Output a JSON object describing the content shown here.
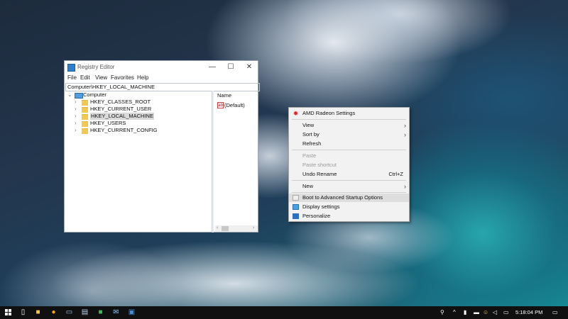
{
  "regedit": {
    "title": "Registry Editor",
    "controls": {
      "minimize": "—",
      "maximize": "☐",
      "close": "✕"
    },
    "menu": [
      "File",
      "Edit",
      "View",
      "Favorites",
      "Help"
    ],
    "address": "Computer\\HKEY_LOCAL_MACHINE",
    "tree": {
      "root": "Computer",
      "items": [
        "HKEY_CLASSES_ROOT",
        "HKEY_CURRENT_USER",
        "HKEY_LOCAL_MACHINE",
        "HKEY_USERS",
        "HKEY_CURRENT_CONFIG"
      ],
      "selected": "HKEY_LOCAL_MACHINE"
    },
    "values": {
      "column_name": "Name",
      "default_icon": "ab",
      "default_name": "(Default)"
    }
  },
  "context_menu": {
    "amd": "AMD Radeon Settings",
    "view": "View",
    "sort_by": "Sort by",
    "refresh": "Refresh",
    "paste": "Paste",
    "paste_shortcut": "Paste shortcut",
    "undo_rename": "Undo Rename",
    "undo_shortcut": "Ctrl+Z",
    "new": "New",
    "boot": "Boot to Advanced Startup Options",
    "display": "Display settings",
    "personalize": "Personalize"
  },
  "taskbar": {
    "clock": "5:18:04 PM",
    "pinned_icons": [
      "task-view-icon",
      "file-explorer-icon",
      "chrome-icon",
      "network-computer-icon",
      "document-icon",
      "chat-icon",
      "mail-icon",
      "registry-editor-icon"
    ],
    "tray_icons": [
      "people-icon",
      "chevron-up-icon",
      "network-icon",
      "battery-icon",
      "emoji-icon",
      "volume-icon",
      "action-center-icon"
    ]
  }
}
